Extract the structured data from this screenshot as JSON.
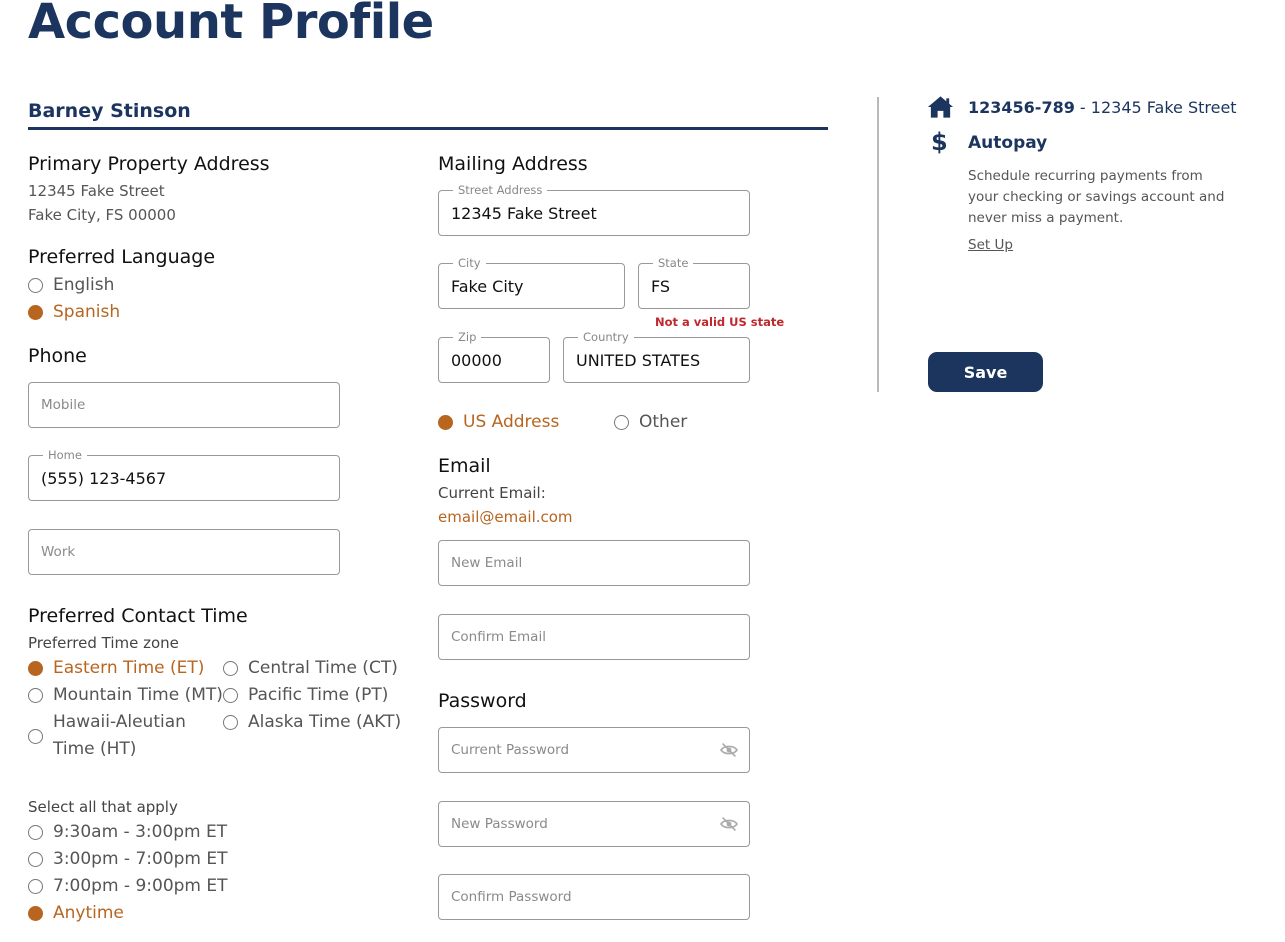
{
  "page": {
    "title": "Account Profile"
  },
  "user": {
    "name": "Barney Stinson"
  },
  "primary_address": {
    "heading": "Primary Property Address",
    "line1": "12345 Fake Street",
    "line2": "Fake City, FS 00000"
  },
  "language": {
    "heading": "Preferred Language",
    "options": [
      {
        "label": "English",
        "selected": false
      },
      {
        "label": "Spanish",
        "selected": true
      }
    ]
  },
  "phone": {
    "heading": "Phone",
    "mobile": {
      "placeholder": "Mobile",
      "value": ""
    },
    "home": {
      "label": "Home",
      "value": "(555) 123-4567"
    },
    "work": {
      "placeholder": "Work",
      "value": ""
    }
  },
  "contact_time": {
    "heading": "Preferred Contact Time",
    "timezone_label": "Preferred Time zone",
    "timezones": [
      {
        "label": "Eastern Time (ET)",
        "selected": true
      },
      {
        "label": "Central Time (CT)",
        "selected": false
      },
      {
        "label": "Mountain Time (MT)",
        "selected": false
      },
      {
        "label": "Pacific Time (PT)",
        "selected": false
      },
      {
        "label": "Hawaii-Aleutian Time (HT)",
        "selected": false
      },
      {
        "label": "Alaska Time (AKT)",
        "selected": false
      }
    ],
    "slots_label": "Select all that apply",
    "slots": [
      {
        "label": "9:30am - 3:00pm ET",
        "selected": false
      },
      {
        "label": "3:00pm - 7:00pm ET",
        "selected": false
      },
      {
        "label": "7:00pm - 9:00pm ET",
        "selected": false
      },
      {
        "label": "Anytime",
        "selected": true
      }
    ]
  },
  "mailing": {
    "heading": "Mailing Address",
    "street": {
      "label": "Street Address",
      "value": "12345 Fake Street"
    },
    "city": {
      "label": "City",
      "value": "Fake City"
    },
    "state": {
      "label": "State",
      "value": "FS",
      "error": "Not a valid US state"
    },
    "zip": {
      "label": "Zip",
      "value": "00000"
    },
    "country": {
      "label": "Country",
      "value": "UNITED STATES"
    },
    "address_type": [
      {
        "label": "US Address",
        "selected": true
      },
      {
        "label": "Other",
        "selected": false
      }
    ]
  },
  "email": {
    "heading": "Email",
    "current_label": "Current Email:",
    "current_value": "email@email.com",
    "new_placeholder": "New Email",
    "confirm_placeholder": "Confirm Email"
  },
  "password": {
    "heading": "Password",
    "current_placeholder": "Current Password",
    "new_placeholder": "New Password",
    "confirm_placeholder": "Confirm Password"
  },
  "account": {
    "number": "123456-789",
    "separator": " - ",
    "address": "12345 Fake Street",
    "icon": "home-icon"
  },
  "autopay": {
    "title": "Autopay",
    "icon": "dollar-icon",
    "description": "Schedule recurring payments from your checking or savings account and never miss a payment.",
    "link": "Set Up"
  },
  "actions": {
    "save_label": "Save"
  },
  "colors": {
    "navy": "#1b355e",
    "accent": "#b8651f",
    "error": "#c0282c"
  }
}
